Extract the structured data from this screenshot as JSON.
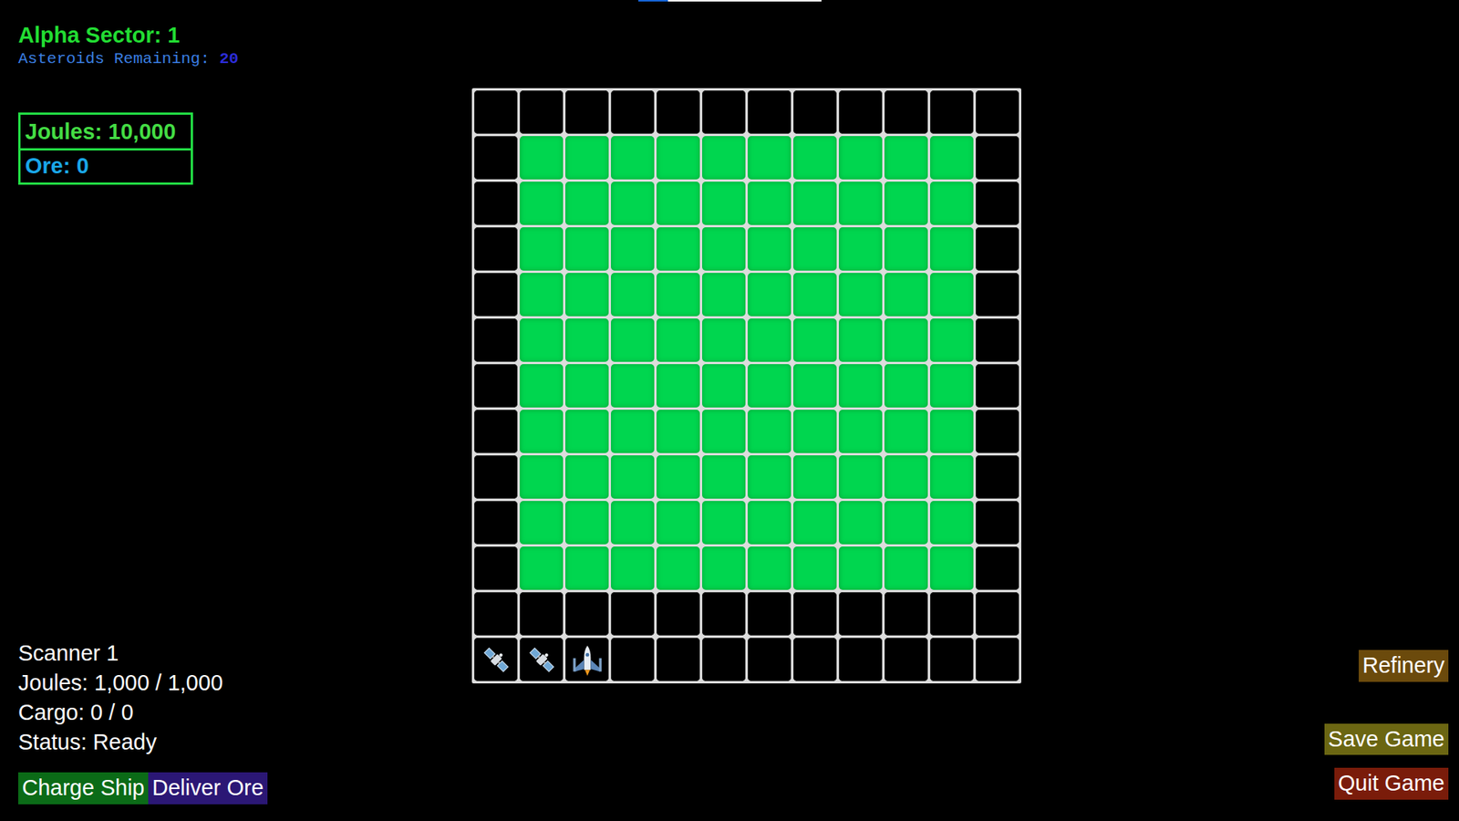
{
  "sector": {
    "label": "Alpha Sector: 1"
  },
  "asteroids": {
    "label": "Asteroids Remaining:",
    "count": "20"
  },
  "resources": [
    {
      "text": "Joules: 10,000",
      "color": "#44dd44"
    },
    {
      "text": "Ore: 0",
      "color": "#1aa7e8"
    }
  ],
  "top_bar": {
    "level": 0.16
  },
  "grid": {
    "rows": [
      {
        "cells": [
          {
            "kind": "space"
          },
          {
            "kind": "space"
          },
          {
            "kind": "space"
          },
          {
            "kind": "space"
          },
          {
            "kind": "space"
          },
          {
            "kind": "space"
          },
          {
            "kind": "space"
          },
          {
            "kind": "space"
          },
          {
            "kind": "space"
          },
          {
            "kind": "space"
          },
          {
            "kind": "space"
          },
          {
            "kind": "space"
          }
        ]
      },
      {
        "cells": [
          {
            "kind": "space"
          },
          {
            "kind": "field"
          },
          {
            "kind": "field"
          },
          {
            "kind": "field"
          },
          {
            "kind": "field"
          },
          {
            "kind": "field"
          },
          {
            "kind": "field"
          },
          {
            "kind": "field"
          },
          {
            "kind": "field"
          },
          {
            "kind": "field"
          },
          {
            "kind": "field"
          },
          {
            "kind": "space"
          }
        ]
      },
      {
        "cells": [
          {
            "kind": "space"
          },
          {
            "kind": "field"
          },
          {
            "kind": "field"
          },
          {
            "kind": "field"
          },
          {
            "kind": "field"
          },
          {
            "kind": "field"
          },
          {
            "kind": "field"
          },
          {
            "kind": "field"
          },
          {
            "kind": "field"
          },
          {
            "kind": "field"
          },
          {
            "kind": "field"
          },
          {
            "kind": "space"
          }
        ]
      },
      {
        "cells": [
          {
            "kind": "space"
          },
          {
            "kind": "field"
          },
          {
            "kind": "field"
          },
          {
            "kind": "field"
          },
          {
            "kind": "field"
          },
          {
            "kind": "field"
          },
          {
            "kind": "field"
          },
          {
            "kind": "field"
          },
          {
            "kind": "field"
          },
          {
            "kind": "field"
          },
          {
            "kind": "field"
          },
          {
            "kind": "space"
          }
        ]
      },
      {
        "cells": [
          {
            "kind": "space"
          },
          {
            "kind": "field"
          },
          {
            "kind": "field"
          },
          {
            "kind": "field"
          },
          {
            "kind": "field"
          },
          {
            "kind": "field"
          },
          {
            "kind": "field"
          },
          {
            "kind": "field"
          },
          {
            "kind": "field"
          },
          {
            "kind": "field"
          },
          {
            "kind": "field"
          },
          {
            "kind": "space"
          }
        ]
      },
      {
        "cells": [
          {
            "kind": "space"
          },
          {
            "kind": "field"
          },
          {
            "kind": "field"
          },
          {
            "kind": "field"
          },
          {
            "kind": "field"
          },
          {
            "kind": "field"
          },
          {
            "kind": "field"
          },
          {
            "kind": "field"
          },
          {
            "kind": "field"
          },
          {
            "kind": "field"
          },
          {
            "kind": "field"
          },
          {
            "kind": "space"
          }
        ]
      },
      {
        "cells": [
          {
            "kind": "space"
          },
          {
            "kind": "field"
          },
          {
            "kind": "field"
          },
          {
            "kind": "field"
          },
          {
            "kind": "field"
          },
          {
            "kind": "field"
          },
          {
            "kind": "field"
          },
          {
            "kind": "field"
          },
          {
            "kind": "field"
          },
          {
            "kind": "field"
          },
          {
            "kind": "field"
          },
          {
            "kind": "space"
          }
        ]
      },
      {
        "cells": [
          {
            "kind": "space"
          },
          {
            "kind": "field"
          },
          {
            "kind": "field"
          },
          {
            "kind": "field"
          },
          {
            "kind": "field"
          },
          {
            "kind": "field"
          },
          {
            "kind": "field"
          },
          {
            "kind": "field"
          },
          {
            "kind": "field"
          },
          {
            "kind": "field"
          },
          {
            "kind": "field"
          },
          {
            "kind": "space"
          }
        ]
      },
      {
        "cells": [
          {
            "kind": "space"
          },
          {
            "kind": "field"
          },
          {
            "kind": "field"
          },
          {
            "kind": "field"
          },
          {
            "kind": "field"
          },
          {
            "kind": "field"
          },
          {
            "kind": "field"
          },
          {
            "kind": "field"
          },
          {
            "kind": "field"
          },
          {
            "kind": "field"
          },
          {
            "kind": "field"
          },
          {
            "kind": "space"
          }
        ]
      },
      {
        "cells": [
          {
            "kind": "space"
          },
          {
            "kind": "field"
          },
          {
            "kind": "field"
          },
          {
            "kind": "field"
          },
          {
            "kind": "field"
          },
          {
            "kind": "field"
          },
          {
            "kind": "field"
          },
          {
            "kind": "field"
          },
          {
            "kind": "field"
          },
          {
            "kind": "field"
          },
          {
            "kind": "field"
          },
          {
            "kind": "space"
          }
        ]
      },
      {
        "cells": [
          {
            "kind": "space"
          },
          {
            "kind": "field"
          },
          {
            "kind": "field"
          },
          {
            "kind": "field"
          },
          {
            "kind": "field"
          },
          {
            "kind": "field"
          },
          {
            "kind": "field"
          },
          {
            "kind": "field"
          },
          {
            "kind": "field"
          },
          {
            "kind": "field"
          },
          {
            "kind": "field"
          },
          {
            "kind": "space"
          }
        ]
      },
      {
        "cells": [
          {
            "kind": "space"
          },
          {
            "kind": "space"
          },
          {
            "kind": "space"
          },
          {
            "kind": "space"
          },
          {
            "kind": "space"
          },
          {
            "kind": "space"
          },
          {
            "kind": "space"
          },
          {
            "kind": "space"
          },
          {
            "kind": "space"
          },
          {
            "kind": "space"
          },
          {
            "kind": "space"
          },
          {
            "kind": "space"
          }
        ]
      },
      {
        "cells": [
          {
            "kind": "satellite"
          },
          {
            "kind": "satellite"
          },
          {
            "kind": "ship"
          },
          {
            "kind": "space"
          },
          {
            "kind": "space"
          },
          {
            "kind": "space"
          },
          {
            "kind": "space"
          },
          {
            "kind": "space"
          },
          {
            "kind": "space"
          },
          {
            "kind": "space"
          },
          {
            "kind": "space"
          },
          {
            "kind": "space"
          }
        ]
      }
    ]
  },
  "ship_info": [
    "Scanner 1",
    "Joules: 1,000 / 1,000",
    "Cargo: 0 / 0",
    "Status: Ready"
  ],
  "ship_buttons": [
    {
      "label": "Charge Ship",
      "color": "#0b6b17"
    },
    {
      "label": "Deliver Ore",
      "color": "#2b1775"
    }
  ],
  "menu_buttons": [
    {
      "label": "Refinery",
      "color": "#6b4a0c"
    },
    {
      "label": "Save Game",
      "color": "#6b6612"
    },
    {
      "label": "Quit Game",
      "color": "#7a1c0a"
    }
  ]
}
